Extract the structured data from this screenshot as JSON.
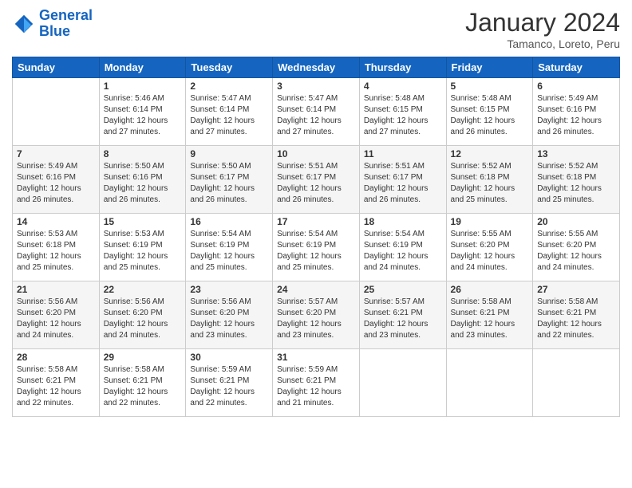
{
  "header": {
    "logo_line1": "General",
    "logo_line2": "Blue",
    "title": "January 2024",
    "subtitle": "Tamanco, Loreto, Peru"
  },
  "days_of_week": [
    "Sunday",
    "Monday",
    "Tuesday",
    "Wednesday",
    "Thursday",
    "Friday",
    "Saturday"
  ],
  "weeks": [
    [
      {
        "day": "",
        "sunrise": "",
        "sunset": "",
        "daylight": ""
      },
      {
        "day": "1",
        "sunrise": "Sunrise: 5:46 AM",
        "sunset": "Sunset: 6:14 PM",
        "daylight": "Daylight: 12 hours and 27 minutes."
      },
      {
        "day": "2",
        "sunrise": "Sunrise: 5:47 AM",
        "sunset": "Sunset: 6:14 PM",
        "daylight": "Daylight: 12 hours and 27 minutes."
      },
      {
        "day": "3",
        "sunrise": "Sunrise: 5:47 AM",
        "sunset": "Sunset: 6:14 PM",
        "daylight": "Daylight: 12 hours and 27 minutes."
      },
      {
        "day": "4",
        "sunrise": "Sunrise: 5:48 AM",
        "sunset": "Sunset: 6:15 PM",
        "daylight": "Daylight: 12 hours and 27 minutes."
      },
      {
        "day": "5",
        "sunrise": "Sunrise: 5:48 AM",
        "sunset": "Sunset: 6:15 PM",
        "daylight": "Daylight: 12 hours and 26 minutes."
      },
      {
        "day": "6",
        "sunrise": "Sunrise: 5:49 AM",
        "sunset": "Sunset: 6:16 PM",
        "daylight": "Daylight: 12 hours and 26 minutes."
      }
    ],
    [
      {
        "day": "7",
        "sunrise": "Sunrise: 5:49 AM",
        "sunset": "Sunset: 6:16 PM",
        "daylight": "Daylight: 12 hours and 26 minutes."
      },
      {
        "day": "8",
        "sunrise": "Sunrise: 5:50 AM",
        "sunset": "Sunset: 6:16 PM",
        "daylight": "Daylight: 12 hours and 26 minutes."
      },
      {
        "day": "9",
        "sunrise": "Sunrise: 5:50 AM",
        "sunset": "Sunset: 6:17 PM",
        "daylight": "Daylight: 12 hours and 26 minutes."
      },
      {
        "day": "10",
        "sunrise": "Sunrise: 5:51 AM",
        "sunset": "Sunset: 6:17 PM",
        "daylight": "Daylight: 12 hours and 26 minutes."
      },
      {
        "day": "11",
        "sunrise": "Sunrise: 5:51 AM",
        "sunset": "Sunset: 6:17 PM",
        "daylight": "Daylight: 12 hours and 26 minutes."
      },
      {
        "day": "12",
        "sunrise": "Sunrise: 5:52 AM",
        "sunset": "Sunset: 6:18 PM",
        "daylight": "Daylight: 12 hours and 25 minutes."
      },
      {
        "day": "13",
        "sunrise": "Sunrise: 5:52 AM",
        "sunset": "Sunset: 6:18 PM",
        "daylight": "Daylight: 12 hours and 25 minutes."
      }
    ],
    [
      {
        "day": "14",
        "sunrise": "Sunrise: 5:53 AM",
        "sunset": "Sunset: 6:18 PM",
        "daylight": "Daylight: 12 hours and 25 minutes."
      },
      {
        "day": "15",
        "sunrise": "Sunrise: 5:53 AM",
        "sunset": "Sunset: 6:19 PM",
        "daylight": "Daylight: 12 hours and 25 minutes."
      },
      {
        "day": "16",
        "sunrise": "Sunrise: 5:54 AM",
        "sunset": "Sunset: 6:19 PM",
        "daylight": "Daylight: 12 hours and 25 minutes."
      },
      {
        "day": "17",
        "sunrise": "Sunrise: 5:54 AM",
        "sunset": "Sunset: 6:19 PM",
        "daylight": "Daylight: 12 hours and 25 minutes."
      },
      {
        "day": "18",
        "sunrise": "Sunrise: 5:54 AM",
        "sunset": "Sunset: 6:19 PM",
        "daylight": "Daylight: 12 hours and 24 minutes."
      },
      {
        "day": "19",
        "sunrise": "Sunrise: 5:55 AM",
        "sunset": "Sunset: 6:20 PM",
        "daylight": "Daylight: 12 hours and 24 minutes."
      },
      {
        "day": "20",
        "sunrise": "Sunrise: 5:55 AM",
        "sunset": "Sunset: 6:20 PM",
        "daylight": "Daylight: 12 hours and 24 minutes."
      }
    ],
    [
      {
        "day": "21",
        "sunrise": "Sunrise: 5:56 AM",
        "sunset": "Sunset: 6:20 PM",
        "daylight": "Daylight: 12 hours and 24 minutes."
      },
      {
        "day": "22",
        "sunrise": "Sunrise: 5:56 AM",
        "sunset": "Sunset: 6:20 PM",
        "daylight": "Daylight: 12 hours and 24 minutes."
      },
      {
        "day": "23",
        "sunrise": "Sunrise: 5:56 AM",
        "sunset": "Sunset: 6:20 PM",
        "daylight": "Daylight: 12 hours and 23 minutes."
      },
      {
        "day": "24",
        "sunrise": "Sunrise: 5:57 AM",
        "sunset": "Sunset: 6:20 PM",
        "daylight": "Daylight: 12 hours and 23 minutes."
      },
      {
        "day": "25",
        "sunrise": "Sunrise: 5:57 AM",
        "sunset": "Sunset: 6:21 PM",
        "daylight": "Daylight: 12 hours and 23 minutes."
      },
      {
        "day": "26",
        "sunrise": "Sunrise: 5:58 AM",
        "sunset": "Sunset: 6:21 PM",
        "daylight": "Daylight: 12 hours and 23 minutes."
      },
      {
        "day": "27",
        "sunrise": "Sunrise: 5:58 AM",
        "sunset": "Sunset: 6:21 PM",
        "daylight": "Daylight: 12 hours and 22 minutes."
      }
    ],
    [
      {
        "day": "28",
        "sunrise": "Sunrise: 5:58 AM",
        "sunset": "Sunset: 6:21 PM",
        "daylight": "Daylight: 12 hours and 22 minutes."
      },
      {
        "day": "29",
        "sunrise": "Sunrise: 5:58 AM",
        "sunset": "Sunset: 6:21 PM",
        "daylight": "Daylight: 12 hours and 22 minutes."
      },
      {
        "day": "30",
        "sunrise": "Sunrise: 5:59 AM",
        "sunset": "Sunset: 6:21 PM",
        "daylight": "Daylight: 12 hours and 22 minutes."
      },
      {
        "day": "31",
        "sunrise": "Sunrise: 5:59 AM",
        "sunset": "Sunset: 6:21 PM",
        "daylight": "Daylight: 12 hours and 21 minutes."
      },
      {
        "day": "",
        "sunrise": "",
        "sunset": "",
        "daylight": ""
      },
      {
        "day": "",
        "sunrise": "",
        "sunset": "",
        "daylight": ""
      },
      {
        "day": "",
        "sunrise": "",
        "sunset": "",
        "daylight": ""
      }
    ]
  ]
}
